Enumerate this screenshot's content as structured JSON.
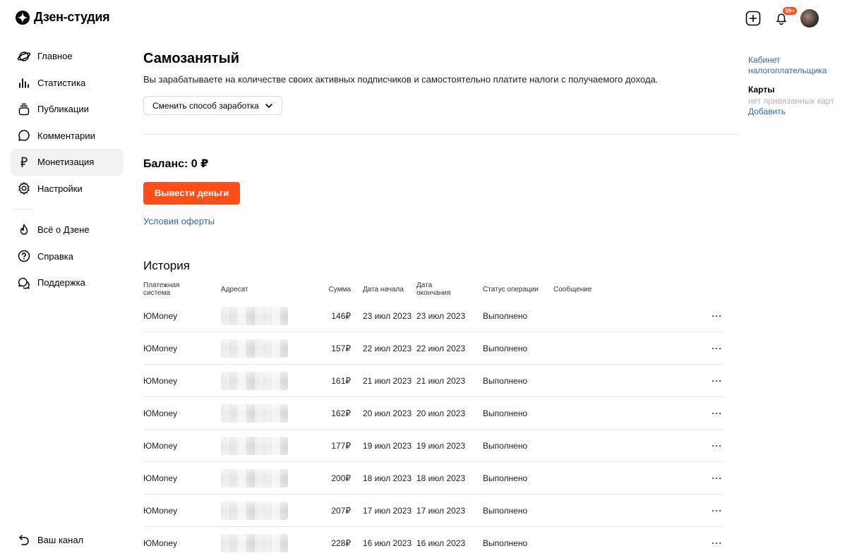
{
  "header": {
    "logo_text": "Дзен-студия",
    "notifications_badge": "99+"
  },
  "sidebar": {
    "items": [
      {
        "label": "Главное",
        "icon": "planet-icon"
      },
      {
        "label": "Статистика",
        "icon": "stats-icon"
      },
      {
        "label": "Публикации",
        "icon": "publications-icon"
      },
      {
        "label": "Комментарии",
        "icon": "comment-icon"
      },
      {
        "label": "Монетизация",
        "icon": "ruble-icon",
        "active": true
      },
      {
        "label": "Настройки",
        "icon": "gear-icon"
      }
    ],
    "secondary": [
      {
        "label": "Всё о Дзене",
        "icon": "flame-icon"
      },
      {
        "label": "Справка",
        "icon": "help-icon"
      },
      {
        "label": "Поддержка",
        "icon": "support-icon"
      }
    ],
    "bottom": {
      "label": "Ваш канал",
      "icon": "back-arrow-icon"
    }
  },
  "main": {
    "title": "Самозанятый",
    "description": "Вы зарабатываете на количестве своих активных подписчиков и самостоятельно платите налоги с получаемого дохода.",
    "switch_label": "Сменить способ заработка",
    "balance": "Баланс: 0 ₽",
    "withdraw_label": "Вывести деньги",
    "offer_link": "Условия оферты",
    "history_title": "История",
    "columns": {
      "system": "Платежная система",
      "address": "Адресат",
      "sum": "Сумма",
      "start": "Дата начала",
      "end": "Дата окончания",
      "status": "Статус операции",
      "message": "Сообщение"
    },
    "rows": [
      {
        "system": "ЮMoney",
        "sum": "146₽",
        "start": "23 июл 2023",
        "end": "23 июл 2023",
        "status": "Выполнено"
      },
      {
        "system": "ЮMoney",
        "sum": "157₽",
        "start": "22 июл 2023",
        "end": "22 июл 2023",
        "status": "Выполнено"
      },
      {
        "system": "ЮMoney",
        "sum": "161₽",
        "start": "21 июл 2023",
        "end": "21 июл 2023",
        "status": "Выполнено"
      },
      {
        "system": "ЮMoney",
        "sum": "162₽",
        "start": "20 июл 2023",
        "end": "20 июл 2023",
        "status": "Выполнено"
      },
      {
        "system": "ЮMoney",
        "sum": "177₽",
        "start": "19 июл 2023",
        "end": "19 июл 2023",
        "status": "Выполнено"
      },
      {
        "system": "ЮMoney",
        "sum": "200₽",
        "start": "18 июл 2023",
        "end": "18 июл 2023",
        "status": "Выполнено"
      },
      {
        "system": "ЮMoney",
        "sum": "207₽",
        "start": "17 июл 2023",
        "end": "17 июл 2023",
        "status": "Выполнено"
      },
      {
        "system": "ЮMoney",
        "sum": "228₽",
        "start": "16 июл 2023",
        "end": "16 июл 2023",
        "status": "Выполнено"
      }
    ],
    "row_menu": "···"
  },
  "right_panel": {
    "tax_cabinet_link": "Кабинет налогоплательщика",
    "cards_title": "Карты",
    "cards_empty": "нет привязанных карт",
    "add_link": "Добавить"
  },
  "colors": {
    "accent": "#ff4f19",
    "link": "#2e69b3",
    "active_bg": "#f2f2f2"
  }
}
